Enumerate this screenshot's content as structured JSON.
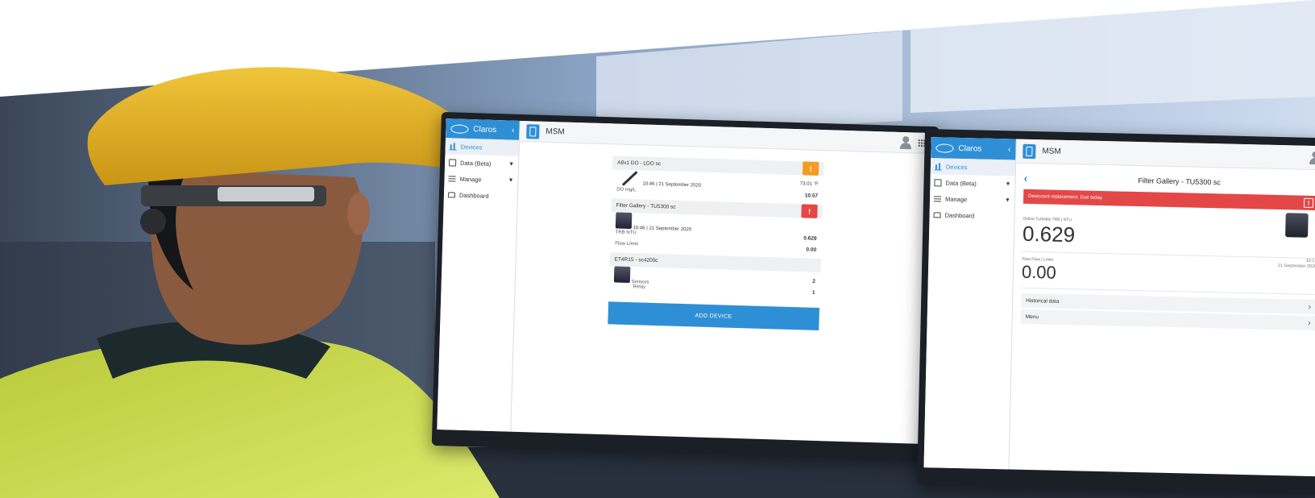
{
  "left_monitor": {
    "brand": "Claros",
    "collapse_icon": "chevron-left-icon",
    "nav": [
      {
        "label": "Devices",
        "icon": "devices-icon",
        "active": true
      },
      {
        "label": "Data (Beta)",
        "icon": "document-icon",
        "arrow": "▼"
      },
      {
        "label": "Manage",
        "icon": "list-icon",
        "arrow": "▼"
      },
      {
        "label": "Dashboard",
        "icon": "dashboard-icon"
      }
    ],
    "topbar_title": "MSM",
    "devices": [
      {
        "name": "A8x1 DO - LDO sc",
        "status": "!",
        "timestamp": "10:46 | 21 September 2020",
        "temp": "73.01 °F",
        "rows": [
          {
            "label": "DO mg/L",
            "value": "10.57"
          }
        ]
      },
      {
        "name": "Filter Gallery - TU5300 sc",
        "status": "!",
        "timestamp": "10:46 | 21 September 2020",
        "rows": [
          {
            "label": "TRB NTU",
            "value": "0.629"
          },
          {
            "label": "Flow L/min",
            "value": "0.00"
          }
        ]
      },
      {
        "name": "ET4R15 - sc4200c",
        "rows": [
          {
            "label": "Sensors",
            "value": "2"
          },
          {
            "label": "Relay",
            "value": "1"
          }
        ]
      }
    ],
    "add_device": "ADD DEVICE"
  },
  "right_monitor": {
    "brand": "Claros",
    "nav": [
      {
        "label": "Devices",
        "active": true
      },
      {
        "label": "Data (Beta)",
        "arrow": "▼"
      },
      {
        "label": "Manage",
        "arrow": "▼"
      },
      {
        "label": "Dashboard"
      }
    ],
    "topbar_title": "MSM",
    "detail_title": "Filter Gallery - TU5300 sc",
    "alert": "Desiccant replacement. Due today",
    "alert_icon": "!",
    "m1_label": "Online Turbidity TRB | NTU",
    "m1_value": "0.629",
    "m2_label": "Flow Flow | L/min",
    "m2_value": "0.00",
    "timestamp_time": "10:17",
    "timestamp_date": "21 September 2020",
    "links": [
      "Historical data",
      "Menu"
    ]
  },
  "colors": {
    "accent": "#2f8fd6",
    "warning": "#f39b24",
    "error": "#e44747"
  }
}
